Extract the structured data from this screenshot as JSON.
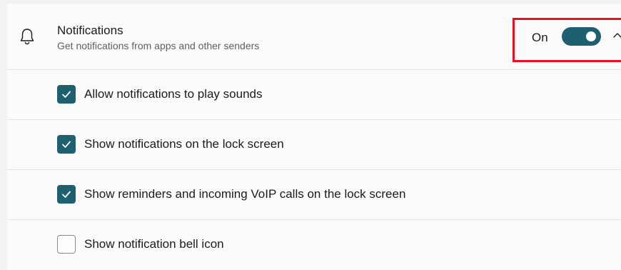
{
  "notifications": {
    "title": "Notifications",
    "subtitle": "Get notifications from apps and other senders",
    "toggle_state_label": "On",
    "toggle_on": true,
    "icon": "bell-icon",
    "expand_icon": "chevron-up-icon"
  },
  "options": [
    {
      "label": "Allow notifications to play sounds",
      "checked": true
    },
    {
      "label": "Show notifications on the lock screen",
      "checked": true
    },
    {
      "label": "Show reminders and incoming VoIP calls on the lock screen",
      "checked": true
    },
    {
      "label": "Show notification bell icon",
      "checked": false
    }
  ],
  "colors": {
    "accent": "#1e5f70",
    "highlight_border": "#e81123"
  }
}
